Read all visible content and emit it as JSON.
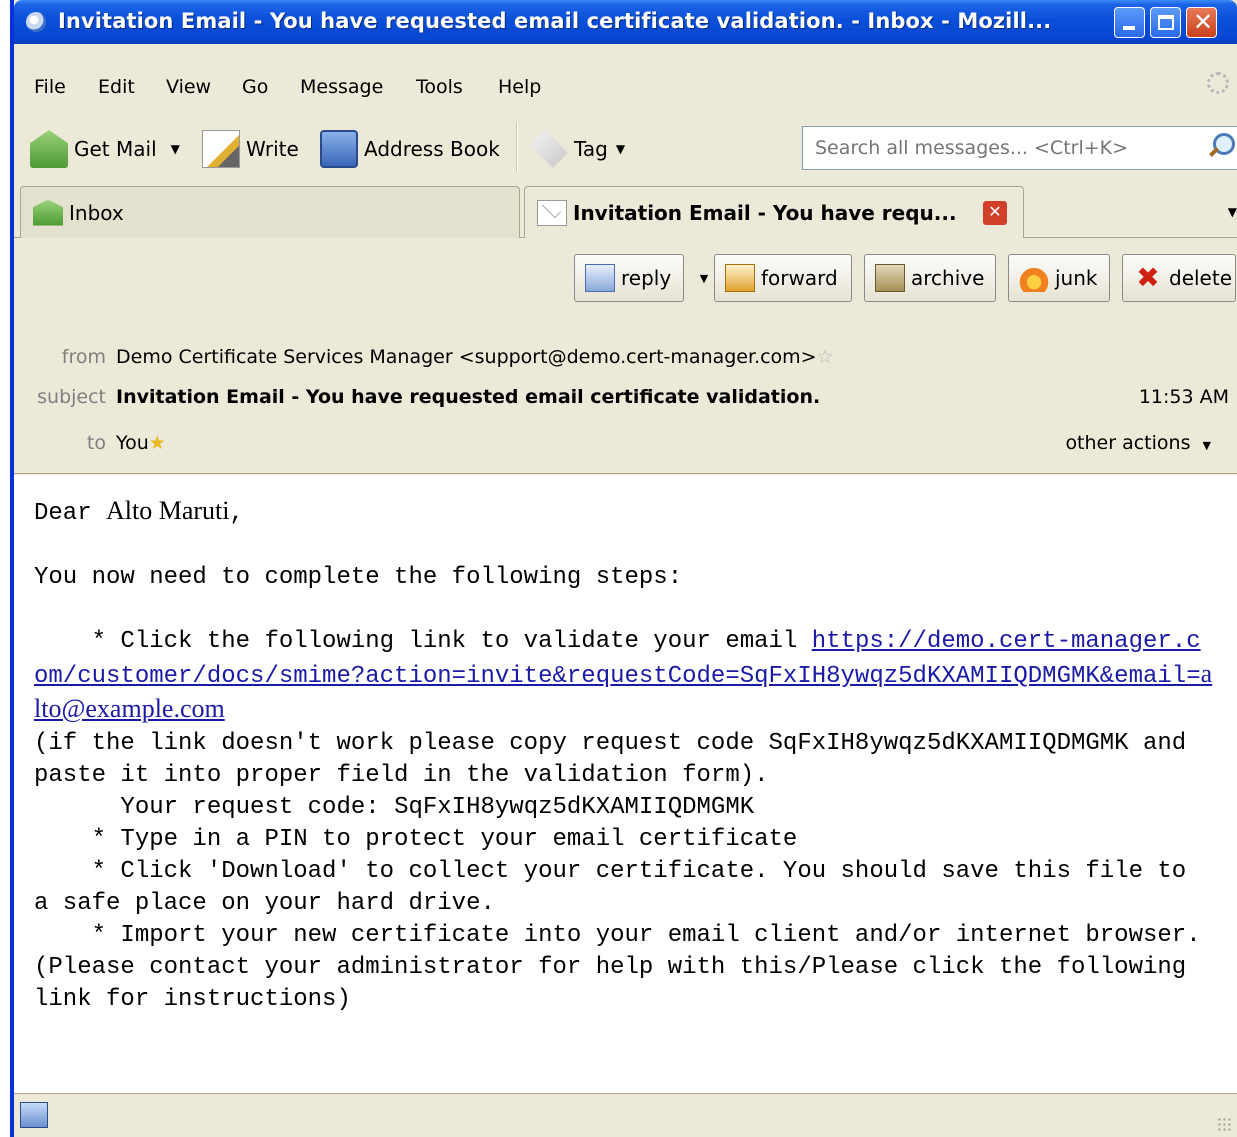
{
  "window": {
    "title": "Invitation Email - You have requested email certificate validation. - Inbox - Mozill..."
  },
  "menu": {
    "items": [
      "File",
      "Edit",
      "View",
      "Go",
      "Message",
      "Tools",
      "Help"
    ]
  },
  "toolbar": {
    "get_mail": "Get Mail",
    "write": "Write",
    "address_book": "Address Book",
    "tag": "Tag",
    "search_placeholder": "Search all messages... <Ctrl+K>"
  },
  "tabs": [
    {
      "label": "Inbox"
    },
    {
      "label": "Invitation Email - You have requ..."
    }
  ],
  "message_actions": {
    "reply": "reply",
    "forward": "forward",
    "archive": "archive",
    "junk": "junk",
    "delete": "delete"
  },
  "header": {
    "from_label": "from",
    "from_value": "Demo Certificate Services Manager <support@demo.cert-manager.com>",
    "subject_label": "subject",
    "subject_value": "Invitation Email - You have requested email certificate validation.",
    "time": "11:53 AM",
    "to_label": "to",
    "to_value": "You",
    "other_actions": "other actions"
  },
  "body": {
    "greeting_prefix": "Dear ",
    "greeting_name": "Alto Maruti",
    "greeting_suffix": ",",
    "intro": "You now need to complete the following steps:",
    "step1_prefix": "    * Click the following link to validate your email ",
    "link_part1": "https://demo.cert-manager.com/customer/docs/smime?action=invite&requestCode=SqFxIH8ywqz5dKXAMIIQDMGMK&email=",
    "link_email": "alto@example.com",
    "note": "(if the link doesn't work please copy request code SqFxIH8ywqz5dKXAMIIQDMGMK and paste it into proper field in the validation form).",
    "request_code_line": "      Your request code: SqFxIH8ywqz5dKXAMIIQDMGMK",
    "step2": "    * Type in a PIN to protect your email certificate",
    "step3": "    * Click 'Download' to collect your certificate. You should save this file to a safe place on your hard drive.",
    "step4": "    * Import your new certificate into your email client and/or internet browser. (Please contact your administrator for help with this/Please click the following link for instructions)"
  }
}
